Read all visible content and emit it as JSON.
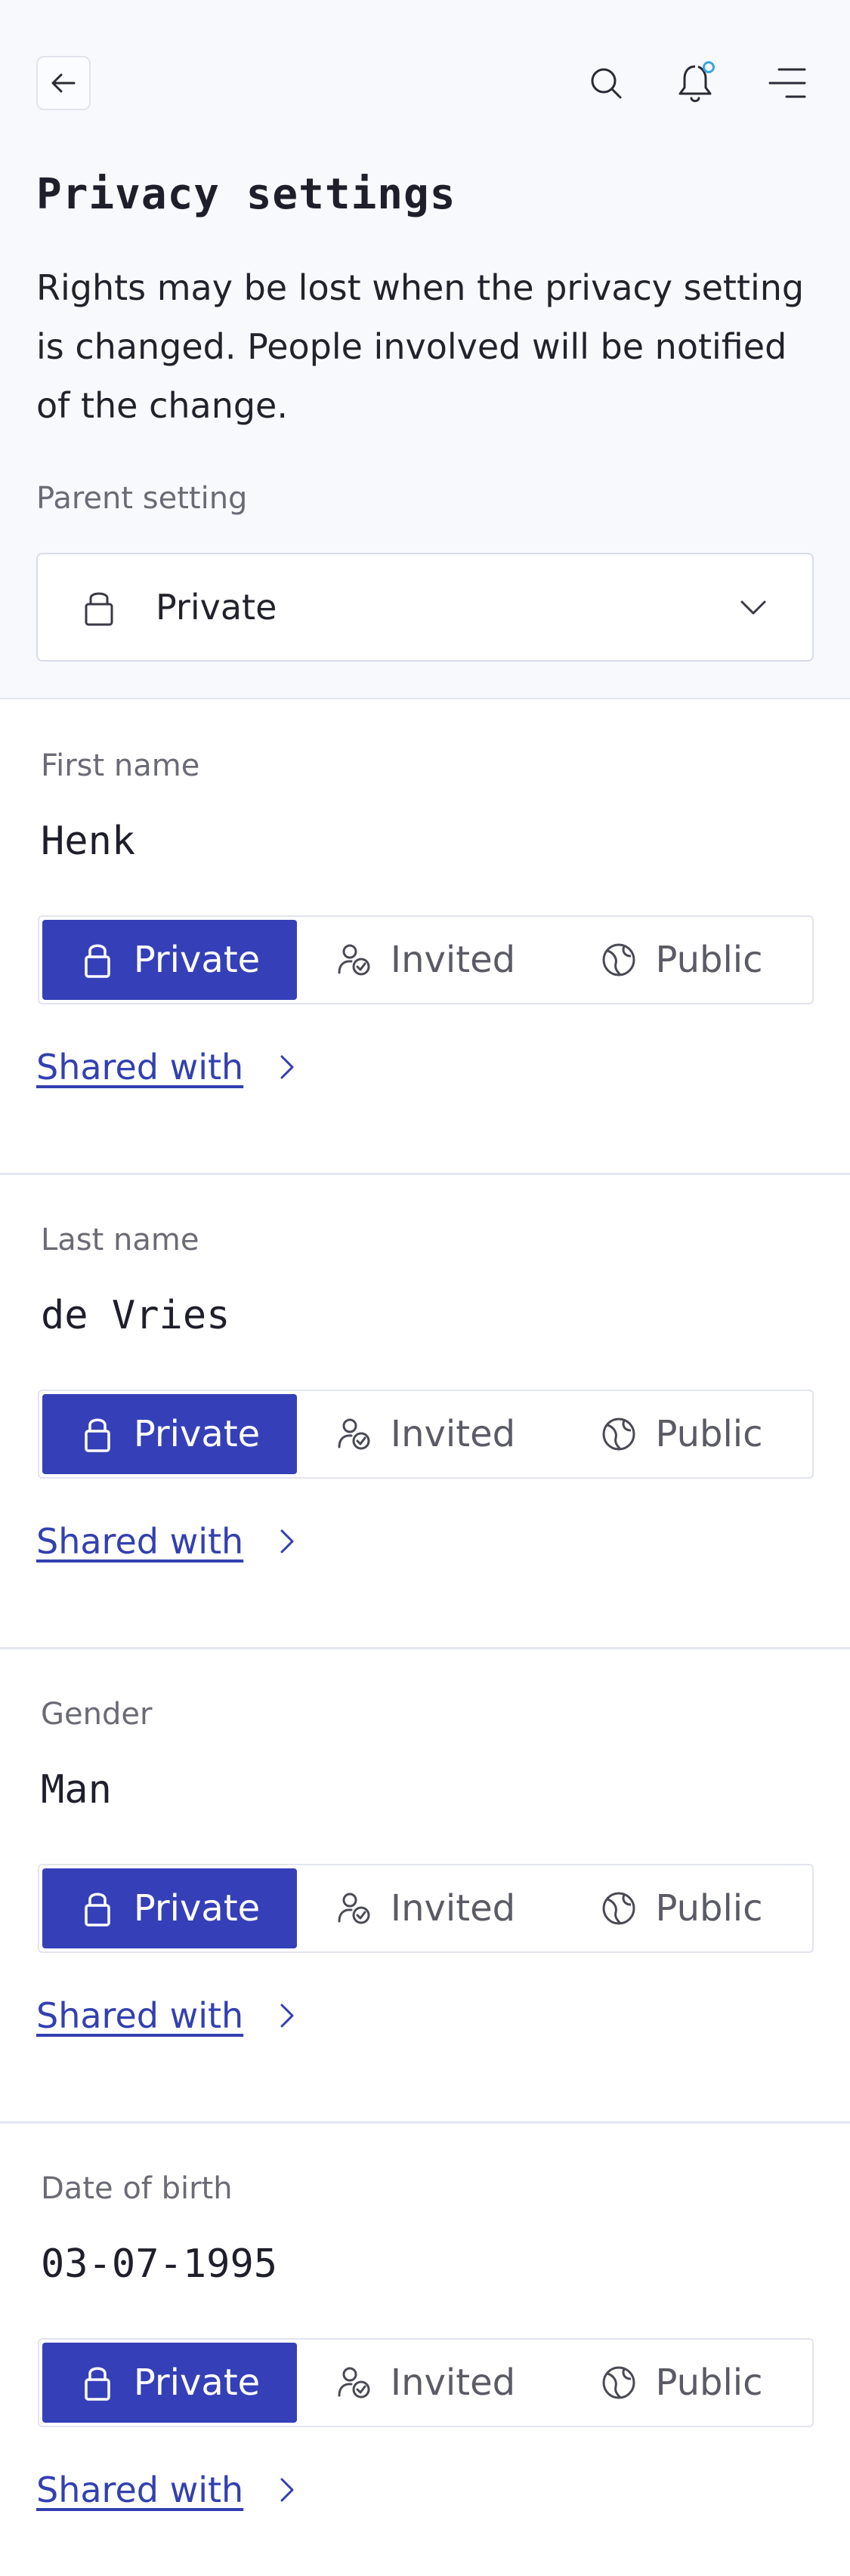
{
  "header": {
    "back_icon": "arrow-left-icon",
    "search_icon": "search-icon",
    "notifications_icon": "bell-icon",
    "menu_icon": "menu-icon",
    "notification_dot_color": "#3aa6e0"
  },
  "page": {
    "title": "Privacy settings",
    "intro": "Rights may be lost when the privacy setting is changed. People involved will be notified of the change."
  },
  "parent_setting": {
    "label": "Parent setting",
    "value": "Private",
    "icon": "lock-icon"
  },
  "colors": {
    "accent": "#3540b8",
    "link": "#3340b0",
    "background_top": "#f8f9fd"
  },
  "fields": [
    {
      "label": "First name",
      "value": "Henk",
      "options": [
        "Private",
        "Invited",
        "Public"
      ],
      "selected": "Private",
      "shared_label": "Shared with"
    },
    {
      "label": "Last name",
      "value": "de Vries",
      "options": [
        "Private",
        "Invited",
        "Public"
      ],
      "selected": "Private",
      "shared_label": "Shared with"
    },
    {
      "label": "Gender",
      "value": "Man",
      "options": [
        "Private",
        "Invited",
        "Public"
      ],
      "selected": "Private",
      "shared_label": "Shared with"
    },
    {
      "label": "Date of birth",
      "value": "03-07-1995",
      "options": [
        "Private",
        "Invited",
        "Public"
      ],
      "selected": "Private",
      "shared_label": "Shared with"
    }
  ]
}
